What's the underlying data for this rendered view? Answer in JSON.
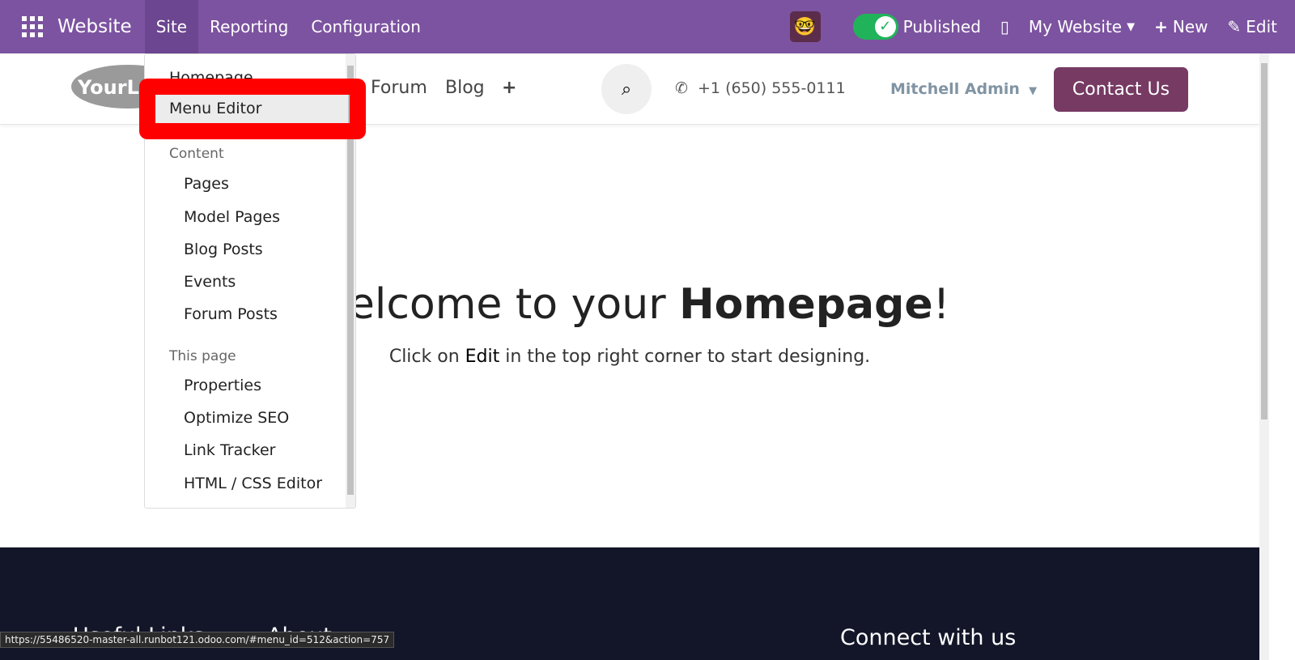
{
  "topbar": {
    "app": "Website",
    "menus": [
      "Site",
      "Reporting",
      "Configuration"
    ],
    "published": "Published",
    "website": "My Website",
    "new": "New",
    "edit": "Edit",
    "accent": "#7c53a0"
  },
  "header": {
    "logo": "YourLogo",
    "nav": [
      "Forum",
      "Blog"
    ],
    "phone": "+1 (650) 555-0111",
    "user": "Mitchell Admin",
    "contact": "Contact Us"
  },
  "hero": {
    "prefix": "Welcome to your ",
    "bold": "Homepage",
    "suffix": "!",
    "sub_prefix": "Click on ",
    "sub_bold": "Edit",
    "sub_suffix": " in the top right corner to start designing."
  },
  "dropdown": {
    "items": [
      "Homepage",
      "Menu Editor"
    ],
    "content_head": "Content",
    "content": [
      "Pages",
      "Model Pages",
      "Blog Posts",
      "Events",
      "Forum Posts"
    ],
    "page_head": "This page",
    "page": [
      "Properties",
      "Optimize SEO",
      "Link Tracker",
      "HTML / CSS Editor"
    ]
  },
  "footer": {
    "col1": "Useful Links",
    "col2": "About",
    "col3": "Connect with us"
  },
  "status_url": "https://55486520-master-all.runbot121.odoo.com/#menu_id=512&action=757"
}
